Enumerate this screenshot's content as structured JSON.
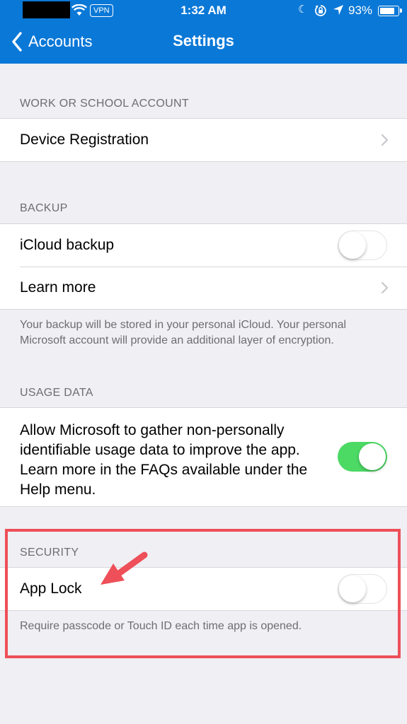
{
  "status_bar": {
    "vpn": "VPN",
    "time": "1:32 AM",
    "battery": "93%",
    "battery_level": 0.93
  },
  "nav": {
    "back_label": "Accounts",
    "title": "Settings"
  },
  "sections": {
    "work": {
      "header": "WORK OR SCHOOL ACCOUNT",
      "device_registration": "Device Registration"
    },
    "backup": {
      "header": "BACKUP",
      "icloud_backup": "iCloud backup",
      "icloud_backup_on": false,
      "learn_more": "Learn more",
      "footer": "Your backup will be stored in your personal iCloud. Your personal Microsoft account will provide an additional layer of encryption."
    },
    "usage": {
      "header": "USAGE DATA",
      "text": "Allow Microsoft to gather non-personally identifiable usage data to improve the app. Learn more in the FAQs available under the Help menu.",
      "on": true
    },
    "security": {
      "header": "SECURITY",
      "app_lock": "App Lock",
      "app_lock_on": false,
      "footer": "Require passcode or Touch ID each time app is opened."
    }
  },
  "colors": {
    "header_bg": "#0a78d7",
    "toggle_on": "#4cd964",
    "highlight": "#ee4f58"
  }
}
